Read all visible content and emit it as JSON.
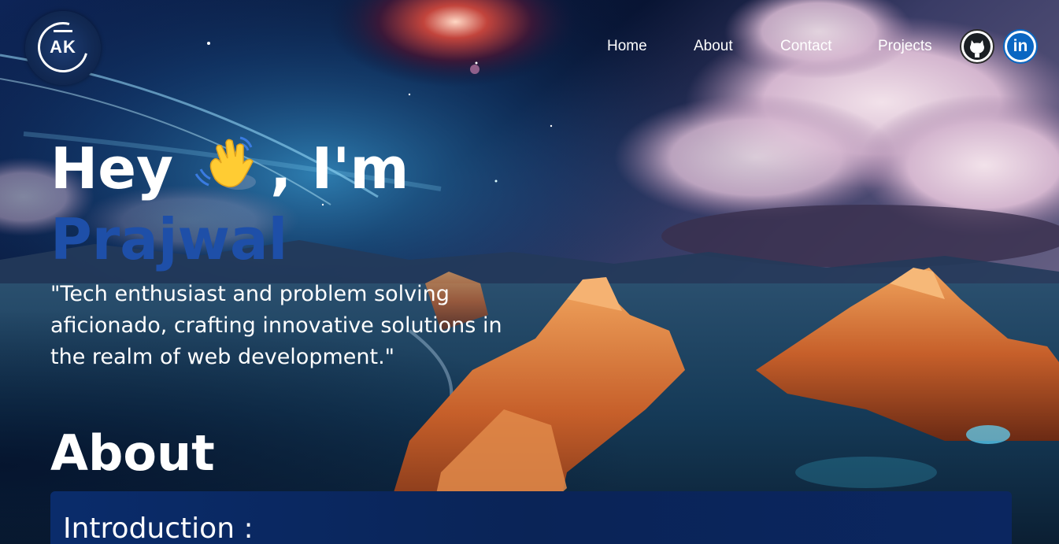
{
  "logo": {
    "text": "AK"
  },
  "nav": {
    "items": [
      {
        "label": "Home"
      },
      {
        "label": "About"
      },
      {
        "label": "Contact"
      },
      {
        "label": "Projects"
      }
    ],
    "social": [
      {
        "name": "github",
        "icon": "github-icon"
      },
      {
        "name": "linkedin",
        "icon": "linkedin-icon",
        "glyph": "in"
      }
    ]
  },
  "hero": {
    "greeting_before": "Hey ",
    "wave_icon": "waving-hand-icon",
    "greeting_after": ", I'm",
    "name": "Prajwal",
    "quote": "\"Tech enthusiast and problem solving aficionado, crafting innovative solutions in the realm of web development.\""
  },
  "about": {
    "title": "About",
    "intro_title": "Introduction :"
  },
  "colors": {
    "name_blue": "#1e4fa8",
    "card_bg": "#0a2457",
    "linkedin_blue": "#0a66c2"
  }
}
